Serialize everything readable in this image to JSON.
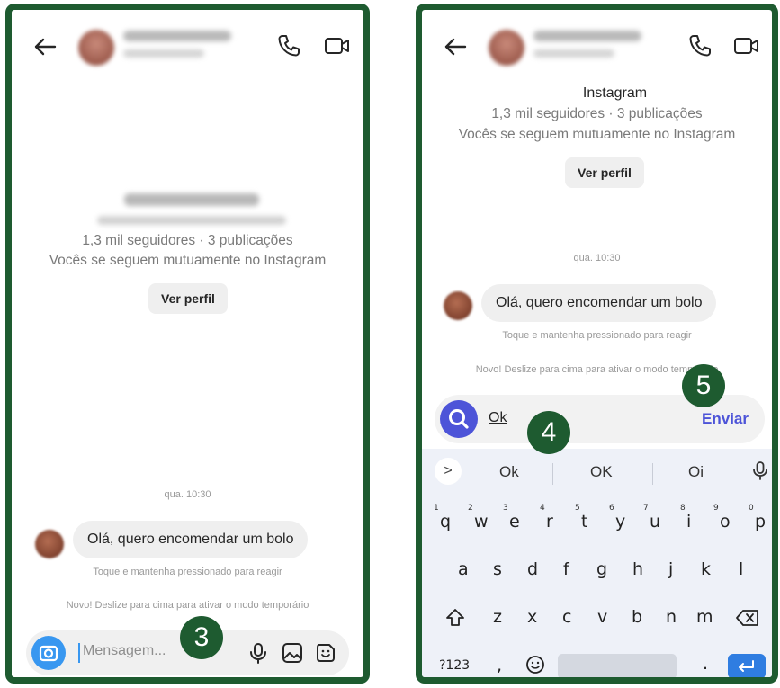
{
  "left_screen": {
    "profile": {
      "followers": "1,3 mil seguidores · 3 publicações",
      "mutual": "Vocês se seguem mutuamente no Instagram",
      "view_profile": "Ver perfil"
    },
    "conversation": {
      "time": "qua. 10:30",
      "message": "Olá, quero encomendar um bolo",
      "react_hint": "Toque e mantenha pressionado para reagir",
      "temp_mode_hint": "Novo! Deslize para cima para ativar o modo temporário"
    },
    "composer": {
      "placeholder": "Mensagem..."
    },
    "step": "3"
  },
  "right_screen": {
    "profile": {
      "platform": "Instagram",
      "followers": "1,3 mil seguidores · 3 publicações",
      "mutual": "Vocês se seguem mutuamente no Instagram",
      "view_profile": "Ver perfil"
    },
    "conversation": {
      "time": "qua. 10:30",
      "message": "Olá, quero encomendar um bolo",
      "react_hint": "Toque e mantenha pressionado para reagir",
      "temp_mode_hint": "Novo! Deslize para cima para ativar o modo temporário"
    },
    "composer": {
      "typed_text": "Ok",
      "send_label": "Enviar"
    },
    "step_4": "4",
    "step_5": "5",
    "keyboard": {
      "suggestions": [
        "Ok",
        "OK",
        "Oi"
      ],
      "expand_symbol": ">",
      "row1": [
        {
          "key": "q",
          "num": "1"
        },
        {
          "key": "w",
          "num": "2"
        },
        {
          "key": "e",
          "num": "3"
        },
        {
          "key": "r",
          "num": "4"
        },
        {
          "key": "t",
          "num": "5"
        },
        {
          "key": "y",
          "num": "6"
        },
        {
          "key": "u",
          "num": "7"
        },
        {
          "key": "i",
          "num": "8"
        },
        {
          "key": "o",
          "num": "9"
        },
        {
          "key": "p",
          "num": "0"
        }
      ],
      "row2": [
        "a",
        "s",
        "d",
        "f",
        "g",
        "h",
        "j",
        "k",
        "l"
      ],
      "row3": [
        "z",
        "x",
        "c",
        "v",
        "b",
        "n",
        "m"
      ],
      "symbols_key": "?123",
      "comma_key": ",",
      "period_key": "."
    }
  },
  "colors": {
    "frame": "#1e5b30",
    "accent_blue": "#3897f0",
    "send_purple": "#4d54d8",
    "enter_blue": "#2f7de1"
  }
}
